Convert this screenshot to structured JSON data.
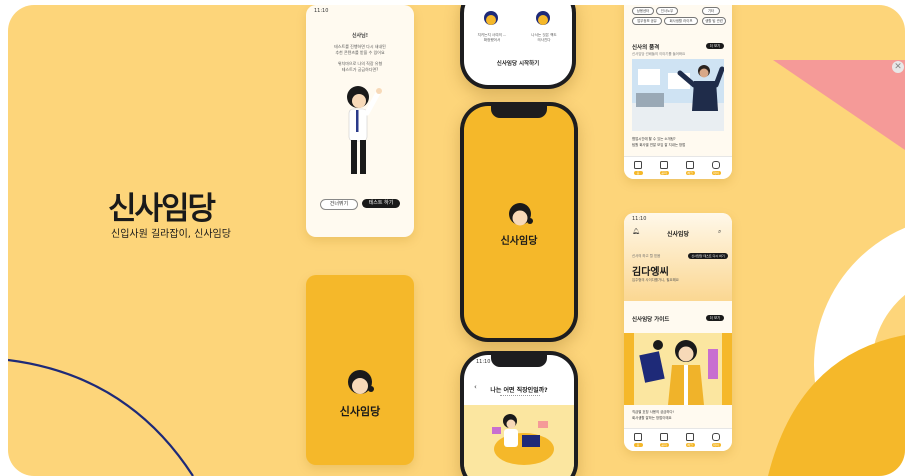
{
  "brand": {
    "title": "신사임당",
    "tagline": "신입사원 길라잡이, 신사임당"
  },
  "onboarding": {
    "status_time": "11:10",
    "heading": "신사님!",
    "desc1": "테스트를 진행하면 다시 새내된",
    "desc2": "추천 콘텐츠를 받을 수 있어요",
    "desc3": "위치마으로 나의 직장 유형",
    "desc4": "테스트가 궁금하다면?",
    "skip_button": "건너뛰기",
    "test_button": "테스트 하기"
  },
  "splash": {
    "logo_text": "신사임당"
  },
  "phone_top": {
    "card1": "지키는지 사여의 ...",
    "card1b": "확정했어서",
    "card2": "나서는 것은 책도",
    "card2b": "의사진다",
    "start_button": "신사임당 시작하기"
  },
  "phone_splash": {
    "logo_text": "신사임당"
  },
  "phone_quiz": {
    "status_time": "11:10",
    "question": "나는 어떤 직장인일까?"
  },
  "feed": {
    "tags": [
      "상용센터",
      "인사노무",
      "기타",
      "업무정보 공유",
      "회사생활 라이프",
      "생활 팁 관련"
    ],
    "section_title": "신사의 품격",
    "section_sub": "신사임당 선배들의 이야기를 들어봐요",
    "more": "더 보기",
    "caption1": "협업시간에 할 수 있는 소개팅?",
    "caption2": "팀원 회사별 연말 모임 잘 지내는 방법",
    "tabs": [
      "홈",
      "공지",
      "체크",
      "마이"
    ]
  },
  "home": {
    "status_time": "11:10",
    "app_title": "신사임당",
    "small_label": "신사의 하고 뭘 믿음",
    "badge": "신사임당 테스트 다시 하기",
    "user_name": "김다엥씨",
    "greeting": "입주형의 사이다를가니, 필요해요",
    "guide_title": "신사임당 가이드",
    "guide_more": "더 보기",
    "caption1": "직급별 호칭 사용의 궁금하다!",
    "caption2": "회사생활 잘하는 방법이에요",
    "tabs": [
      "홈",
      "공지",
      "체크",
      "마이"
    ]
  },
  "colors": {
    "background": "#fdd57a",
    "accent": "#f5b82a",
    "dark": "#1a1a1a",
    "pink": "#f59a98",
    "navy": "#1e2a78"
  }
}
